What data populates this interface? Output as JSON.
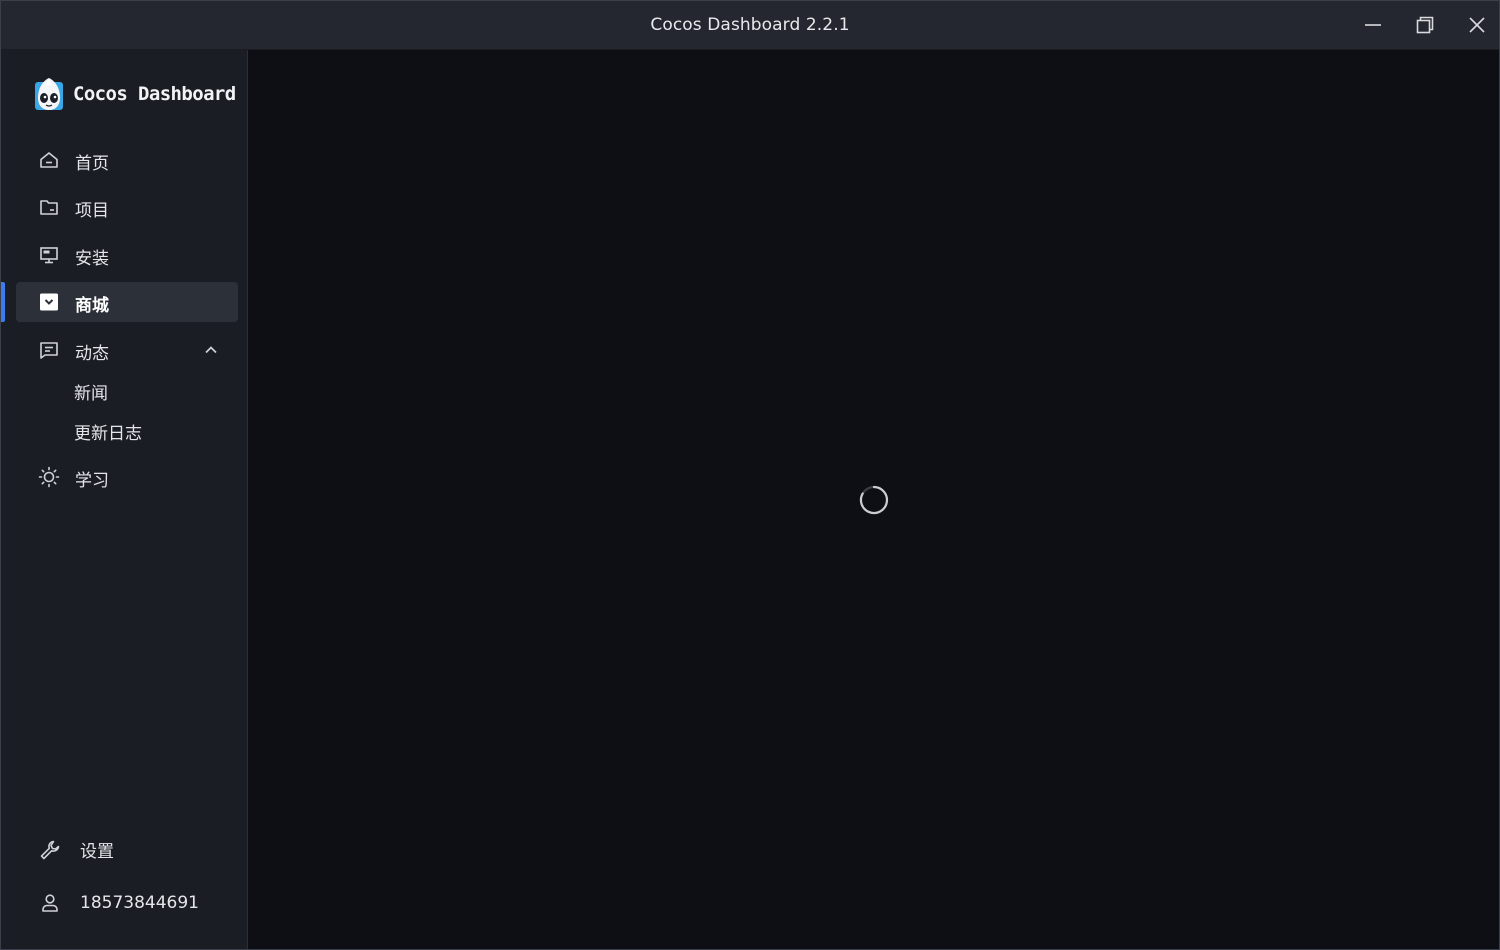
{
  "window": {
    "title": "Cocos Dashboard 2.2.1"
  },
  "sidebar": {
    "brand": "Cocos Dashboard",
    "items": [
      {
        "label": "首页",
        "icon": "home-icon"
      },
      {
        "label": "项目",
        "icon": "folder-icon"
      },
      {
        "label": "安装",
        "icon": "monitor-icon"
      },
      {
        "label": "商城",
        "icon": "store-icon",
        "active": true
      },
      {
        "label": "动态",
        "icon": "news-icon",
        "expanded": true
      },
      {
        "label": "学习",
        "icon": "sun-icon"
      }
    ],
    "dynamic_subitems": [
      "新闻",
      "更新日志"
    ],
    "settings_label": "设置",
    "account_label": "18573844691"
  },
  "main": {
    "state": "loading"
  },
  "colors": {
    "accent": "#3d7bf0",
    "sidebar_bg": "#1a1d23",
    "main_bg": "#0d0f15",
    "titlebar_bg": "#24272f"
  }
}
